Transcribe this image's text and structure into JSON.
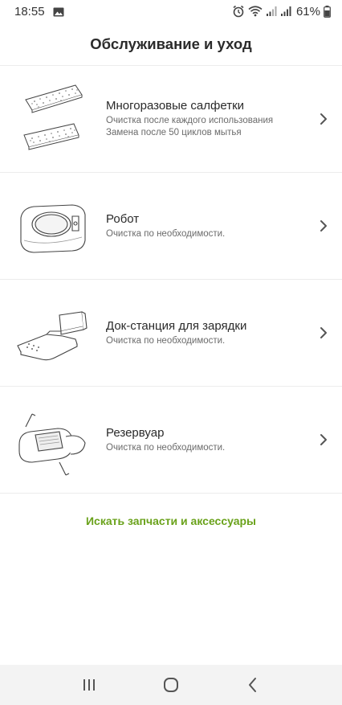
{
  "status": {
    "time": "18:55",
    "battery": "61%"
  },
  "header": {
    "title": "Обслуживание и уход"
  },
  "items": [
    {
      "title": "Многоразовые салфетки",
      "lines": [
        "Очистка после каждого использования",
        "Замена после 50 циклов мытья"
      ]
    },
    {
      "title": "Робот",
      "lines": [
        "Очистка по необходимости."
      ]
    },
    {
      "title": "Док-станция для зарядки",
      "lines": [
        "Очистка по необходимости."
      ]
    },
    {
      "title": "Резервуар",
      "lines": [
        "Очистка по необходимости."
      ]
    }
  ],
  "shop_link": "Искать запчасти и аксессуары",
  "colors": {
    "accent": "#6aa21b",
    "divider": "#ececec",
    "nav_bg": "#f3f3f3"
  },
  "icons": {
    "status": [
      "gallery-icon",
      "alarm-icon",
      "wifi-icon",
      "signal-icon",
      "signal-icon",
      "battery-icon"
    ],
    "rows": [
      "mop-pads-illustration",
      "robot-illustration",
      "dock-illustration",
      "tank-illustration"
    ],
    "nav": [
      "recents-icon",
      "home-icon",
      "back-icon"
    ]
  }
}
